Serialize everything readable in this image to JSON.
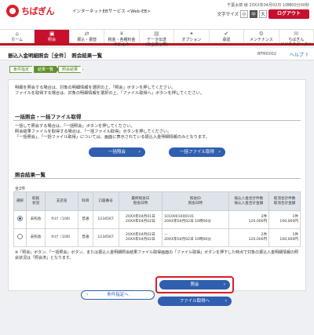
{
  "header": {
    "bank_name": "ちばぎん",
    "service": "インターネットEBサービス <Web-EB>",
    "user_line": "千葉太郎 様 20XX年04月02日 10時00分00秒",
    "fontsize_label": "文字サイズ",
    "fs_small": "小",
    "fs_mid": "中",
    "fs_large": "大",
    "logout": "ログアウト"
  },
  "nav": [
    {
      "icon": "⌂",
      "label": "ホーム"
    },
    {
      "icon": "▣",
      "label": "照会"
    },
    {
      "icon": "⇄",
      "label": "振込・振替"
    },
    {
      "icon": "¥",
      "label": "税金・各種料金\nの払込み"
    },
    {
      "icon": "▤",
      "label": "データ伝送\n(総合振込等)"
    },
    {
      "icon": "✦",
      "label": "オプション"
    },
    {
      "icon": "✔",
      "label": "承認"
    },
    {
      "icon": "⚙",
      "label": "メンテナンス"
    },
    {
      "icon": "✉",
      "label": "ちばぎん\nビジネスポータル"
    }
  ],
  "title": {
    "text": "振込入金明細照会［全件］　照会結果一覧",
    "screen_id": "BFMD002",
    "help": "ヘルプ ?"
  },
  "steps": [
    "条件指定",
    "結果一覧",
    "照会結果"
  ],
  "intro": [
    "明細を照会する場合は、対象の明細情報を選択の上、「照会」ボタンを押してください。",
    "ファイルを取得する場合は、対象の明細情報を選択の上、「ファイル取得へ」ボタンを押してください。"
  ],
  "bulk": {
    "title": "一括照会・一括ファイル取得",
    "notes": [
      "一括して照会する場合は、「一括照会」ボタンを押してください。",
      "照会結果ファイルを取得する場合は、「一括ファイル取得」ボタンを押してください。",
      "「一括照会」、「一括ファイル取得」については、画面に表示されている振込入金明細情報のみとなります。"
    ],
    "btn_query": "一括照会",
    "btn_file": "一括ファイル取得"
  },
  "results": {
    "title": "照会結果一覧",
    "count": "全2件",
    "headers": [
      "選択",
      "取扱\n状況",
      "支店名",
      "科目",
      "口座番号",
      "最終照会日\n照会日時",
      "照会ID\n照会日時",
      "振込入金合計件数\n振込入金合計金額",
      "取消合計件数\n取消合計金額"
    ],
    "rows": [
      {
        "status": "未照会",
        "branch": "わけ（100）",
        "type": "普通",
        "account": "1234567",
        "dates": "20XX年04月01日\n20XX年04月02日",
        "id": "1010001000101\n20XX年04月02日 10時00分",
        "total": "2件\n120,000円",
        "cancel": "1件\n100,000円"
      },
      {
        "status": "未照会",
        "branch": "わけ（100）",
        "type": "普通",
        "account": "1234567",
        "dates": "20XX年04月02日\n20XX年04月02日",
        "id": "－\n20XX年04月02日 10時00分",
        "total": "2件\n120,000円",
        "cancel": "1件\n100,000円"
      }
    ],
    "footnote": "※「照会」ボタン、「一括照会」ボタン、または振込入金明細照会結果ファイル取得画面の「ファイル取得」ボタンを押下した時点で対象の振込入金明細情報の照会状況は「照会済」となります。"
  },
  "actions": {
    "back": "条件指定へ",
    "query": "照会",
    "file": "ファイル取得へ"
  }
}
